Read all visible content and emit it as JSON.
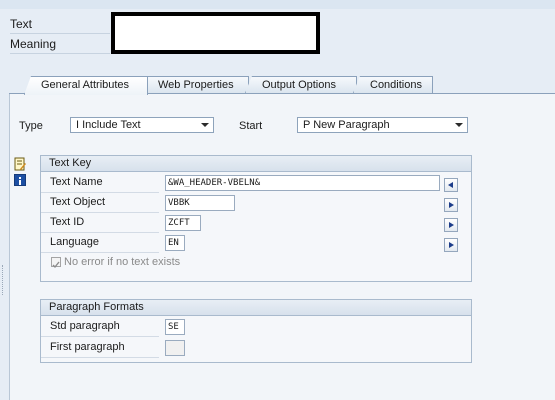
{
  "header": {
    "text_label": "Text",
    "meaning_label": "Meaning"
  },
  "tabs": [
    {
      "label": "General Attributes",
      "active": true
    },
    {
      "label": "Web Properties",
      "active": false
    },
    {
      "label": "Output Options",
      "active": false
    },
    {
      "label": "Conditions",
      "active": false
    }
  ],
  "general": {
    "type_label": "Type",
    "type_value": "I Include Text",
    "start_label": "Start",
    "start_value": "P New Paragraph"
  },
  "text_key": {
    "title": "Text Key",
    "name_label": "Text Name",
    "name_value": "&WA_HEADER-VBELN&",
    "object_label": "Text Object",
    "object_value": "VBBK",
    "id_label": "Text ID",
    "id_value": "ZCFT",
    "language_label": "Language",
    "language_value": "EN",
    "no_error_label": "No error if no text exists",
    "no_error_checked": true
  },
  "paragraph_formats": {
    "title": "Paragraph Formats",
    "std_label": "Std paragraph",
    "std_value": "SE",
    "first_label": "First paragraph",
    "first_value": ""
  },
  "icons": {
    "side_top": "document-edit-icon",
    "side_bottom": "info-icon"
  }
}
